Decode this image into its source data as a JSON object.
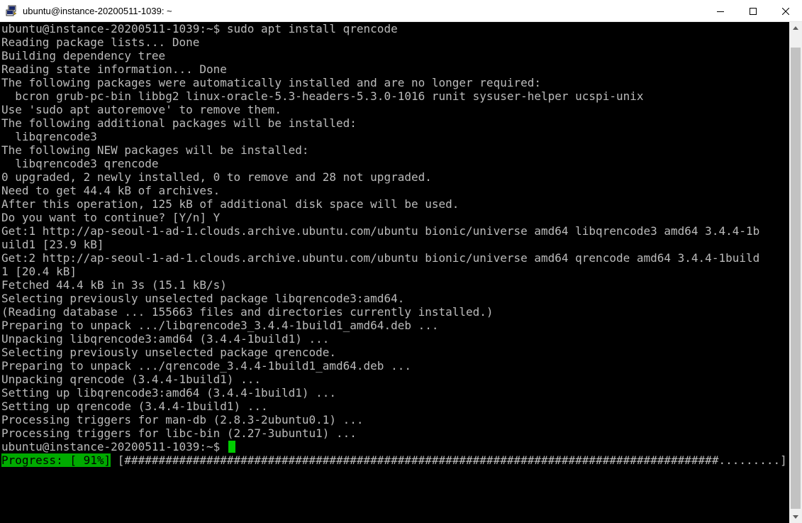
{
  "window": {
    "title": "ubuntu@instance-20200511-1039: ~",
    "icon": "putty-terminal-icon",
    "buttons": {
      "minimize": "minimize-icon",
      "maximize": "maximize-icon",
      "close": "close-icon"
    }
  },
  "terminal": {
    "lines": [
      "ubuntu@instance-20200511-1039:~$ sudo apt install qrencode",
      "Reading package lists... Done",
      "Building dependency tree",
      "Reading state information... Done",
      "The following packages were automatically installed and are no longer required:",
      "  bcron grub-pc-bin libbg2 linux-oracle-5.3-headers-5.3.0-1016 runit sysuser-helper ucspi-unix",
      "Use 'sudo apt autoremove' to remove them.",
      "The following additional packages will be installed:",
      "  libqrencode3",
      "The following NEW packages will be installed:",
      "  libqrencode3 qrencode",
      "0 upgraded, 2 newly installed, 0 to remove and 28 not upgraded.",
      "Need to get 44.4 kB of archives.",
      "After this operation, 125 kB of additional disk space will be used.",
      "Do you want to continue? [Y/n] Y",
      "Get:1 http://ap-seoul-1-ad-1.clouds.archive.ubuntu.com/ubuntu bionic/universe amd64 libqrencode3 amd64 3.4.4-1b",
      "uild1 [23.9 kB]",
      "Get:2 http://ap-seoul-1-ad-1.clouds.archive.ubuntu.com/ubuntu bionic/universe amd64 qrencode amd64 3.4.4-1build",
      "1 [20.4 kB]",
      "Fetched 44.4 kB in 3s (15.1 kB/s)",
      "Selecting previously unselected package libqrencode3:amd64.",
      "(Reading database ... 155663 files and directories currently installed.)",
      "Preparing to unpack .../libqrencode3_3.4.4-1build1_amd64.deb ...",
      "Unpacking libqrencode3:amd64 (3.4.4-1build1) ...",
      "Selecting previously unselected package qrencode.",
      "Preparing to unpack .../qrencode_3.4.4-1build1_amd64.deb ...",
      "Unpacking qrencode (3.4.4-1build1) ...",
      "Setting up libqrencode3:amd64 (3.4.4-1build1) ...",
      "Setting up qrencode (3.4.4-1build1) ...",
      "Processing triggers for man-db (2.8.3-2ubuntu0.1) ...",
      "Processing triggers for libc-bin (2.27-3ubuntu1) ..."
    ],
    "prompt": "ubuntu@instance-20200511-1039:~$ ",
    "progress": {
      "label": "Progress: [ 91%]",
      "percent": 91,
      "bar": " [#######################################################################################.........]"
    },
    "colors": {
      "background": "#000000",
      "text": "#bbbbbb",
      "cursor": "#00cc00",
      "progress_label_bg": "#00aa00"
    }
  },
  "scrollbar": {
    "up": "scroll-up-arrow-icon",
    "down": "scroll-down-arrow-icon"
  }
}
